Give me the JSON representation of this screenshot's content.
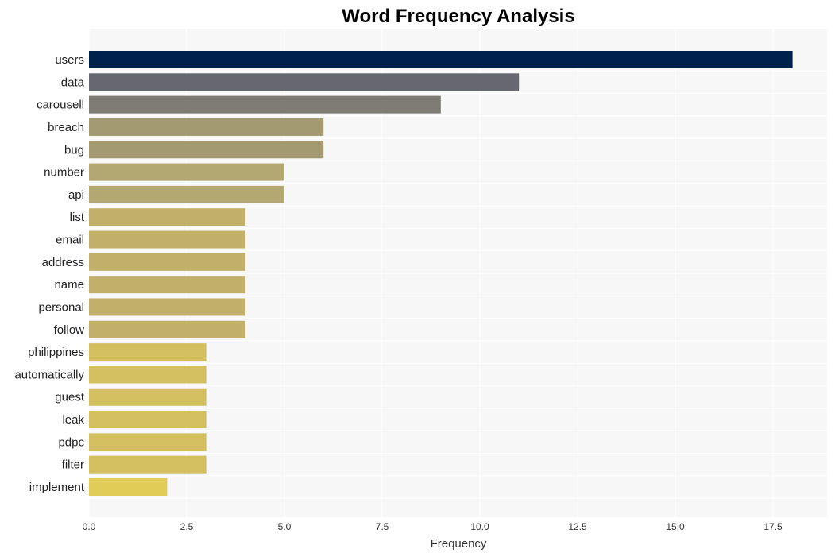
{
  "chart_data": {
    "type": "bar",
    "orientation": "horizontal",
    "title": "Word Frequency Analysis",
    "xlabel": "Frequency",
    "ylabel": "",
    "xlim": [
      0,
      18.9
    ],
    "xticks": [
      0.0,
      2.5,
      5.0,
      7.5,
      10.0,
      12.5,
      15.0,
      17.5
    ],
    "xtick_labels": [
      "0.0",
      "2.5",
      "5.0",
      "7.5",
      "10.0",
      "12.5",
      "15.0",
      "17.5"
    ],
    "grid": true,
    "categories": [
      "users",
      "data",
      "carousell",
      "breach",
      "bug",
      "number",
      "api",
      "list",
      "email",
      "address",
      "name",
      "personal",
      "follow",
      "philippines",
      "automatically",
      "guest",
      "leak",
      "pdpc",
      "filter",
      "implement"
    ],
    "values": [
      18,
      11,
      9,
      6,
      6,
      5,
      5,
      4,
      4,
      4,
      4,
      4,
      4,
      3,
      3,
      3,
      3,
      3,
      3,
      2
    ],
    "colors": [
      "#00214d",
      "#666770",
      "#7d7b73",
      "#a39a72",
      "#a39a72",
      "#b3a772",
      "#b3a772",
      "#c2b06a",
      "#c2b06a",
      "#c2b06a",
      "#c2b06a",
      "#c2b06a",
      "#c2b06a",
      "#d3be60",
      "#d3be60",
      "#d3be60",
      "#d3be60",
      "#d3be60",
      "#d3be60",
      "#e2cc58"
    ],
    "background": "#f7f7f7",
    "gridline_color": "#ffffff"
  }
}
